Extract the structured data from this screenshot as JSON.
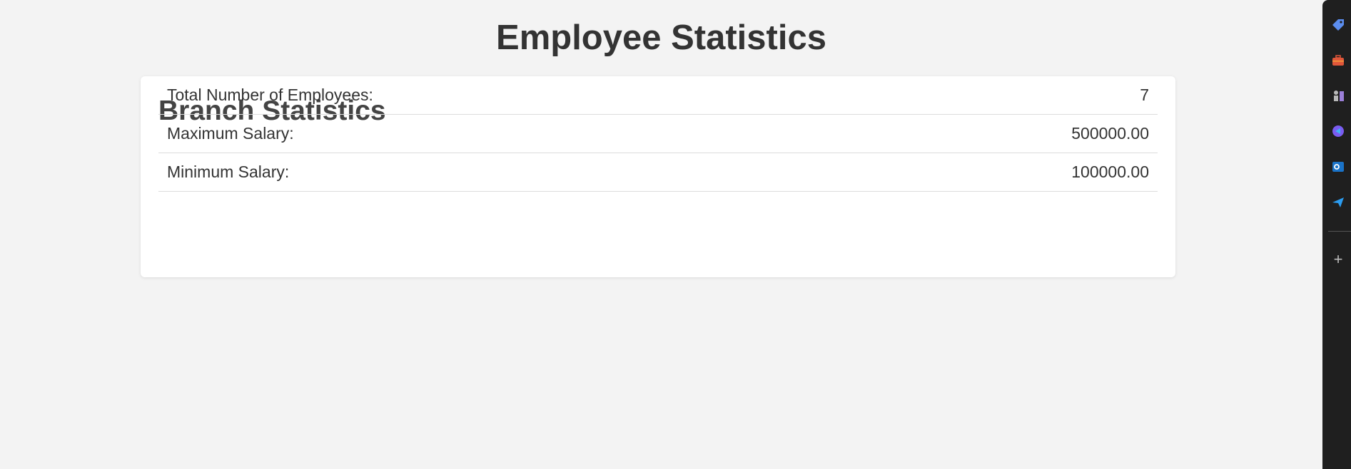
{
  "page": {
    "title": "Employee Statistics"
  },
  "card": {
    "title": "Branch Statistics",
    "rows": [
      {
        "label": "Total Number of Employees:",
        "value": "7"
      },
      {
        "label": "Maximum Salary:",
        "value": "500000.00"
      },
      {
        "label": "Minimum Salary:",
        "value": "100000.00"
      }
    ]
  },
  "sidebar": {
    "icons": [
      "tag-icon",
      "briefcase-icon",
      "chess-icon",
      "copilot-icon",
      "outlook-icon",
      "send-icon",
      "add-icon"
    ],
    "add_label": "+"
  }
}
